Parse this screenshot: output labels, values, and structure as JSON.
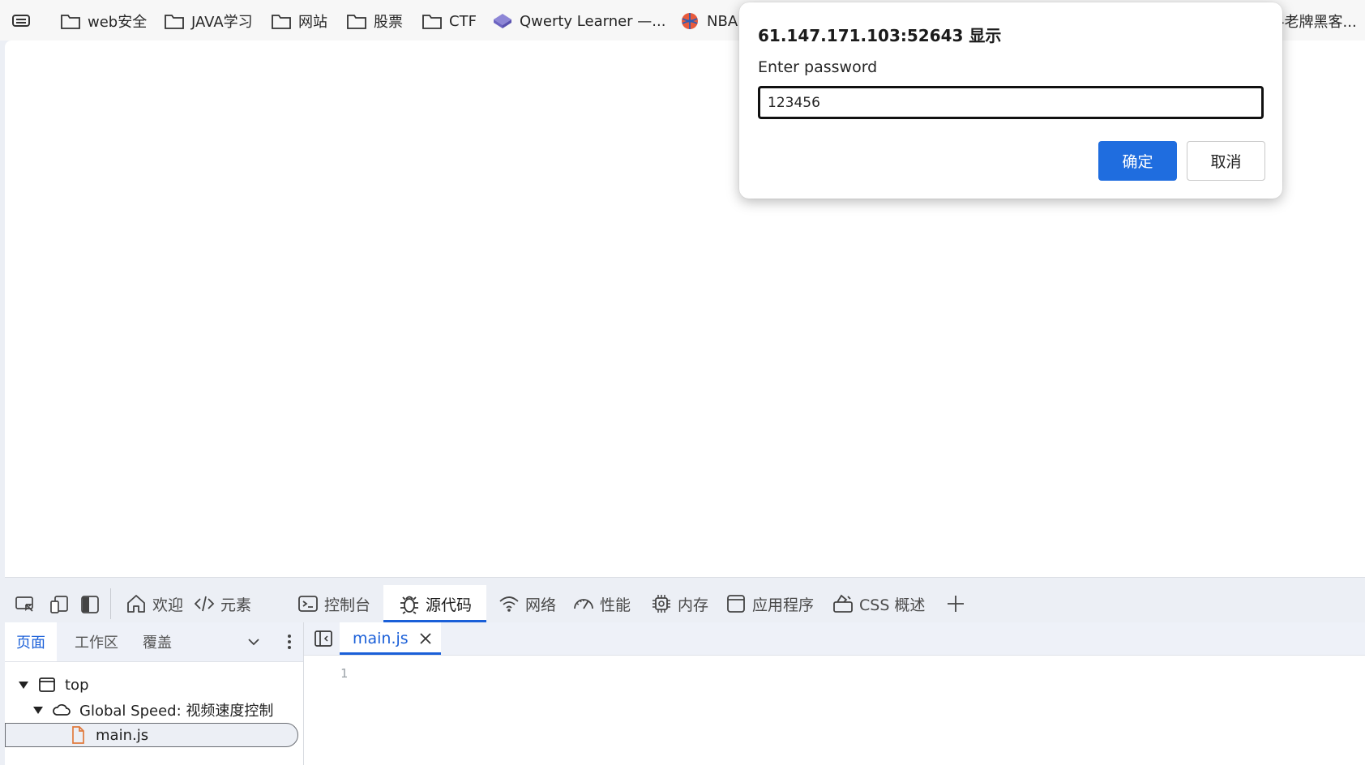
{
  "bookmarks": {
    "root_icon": "bookmarks-menu-icon",
    "items": [
      {
        "label": "web安全",
        "icon": "folder-icon"
      },
      {
        "label": "JAVA学习",
        "icon": "folder-icon"
      },
      {
        "label": "网站",
        "icon": "folder-icon"
      },
      {
        "label": "股票",
        "icon": "folder-icon"
      },
      {
        "label": "CTF",
        "icon": "folder-icon"
      },
      {
        "label": "Qwerty Learner —...",
        "icon": "qwerty-favicon-icon"
      },
      {
        "label": "NBA",
        "icon": "nba-favicon-icon"
      },
      {
        "label": "-老牌黑客...",
        "icon": "none"
      }
    ]
  },
  "dialog": {
    "title": "61.147.171.103:52643 显示",
    "message": "Enter password",
    "input_value": "123456",
    "ok_label": "确定",
    "cancel_label": "取消",
    "accent_color": "#1f6ddf"
  },
  "devtools": {
    "tabs": [
      {
        "label": "欢迎",
        "icon": "home-icon"
      },
      {
        "label": "元素",
        "icon": "code-icon"
      },
      {
        "label": "控制台",
        "icon": "console-icon"
      },
      {
        "label": "源代码",
        "icon": "bug-icon",
        "active": true
      },
      {
        "label": "网络",
        "icon": "wifi-icon"
      },
      {
        "label": "性能",
        "icon": "speedometer-icon"
      },
      {
        "label": "内存",
        "icon": "chip-icon"
      },
      {
        "label": "应用程序",
        "icon": "window-icon"
      },
      {
        "label": "CSS 概述",
        "icon": "paint-icon"
      }
    ],
    "sources": {
      "left_tabs": [
        "页面",
        "工作区",
        "覆盖"
      ],
      "tree": [
        {
          "label": "top",
          "icon": "frame-icon"
        },
        {
          "label": "Global Speed: 视频速度控制",
          "icon": "cloud-icon"
        },
        {
          "label": "main.js",
          "icon": "file-icon"
        }
      ],
      "open_file": "main.js",
      "line_number": "1"
    }
  }
}
